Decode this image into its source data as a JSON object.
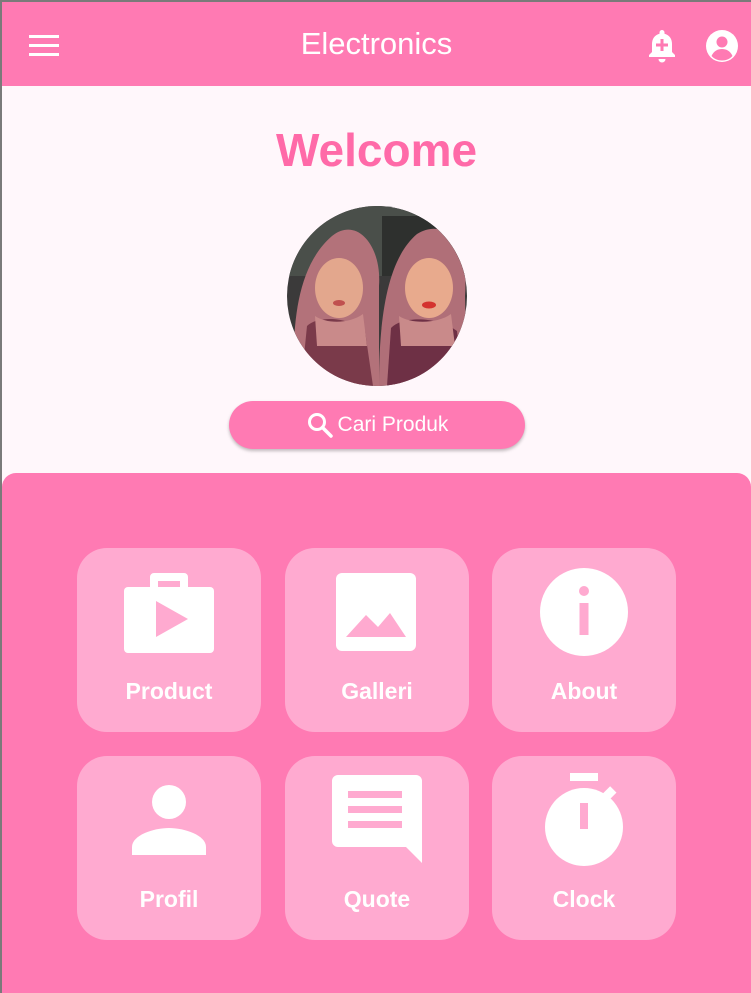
{
  "appbar": {
    "title": "Electronics",
    "menu_icon": "menu-icon",
    "notification_icon": "notification-add-icon",
    "account_icon": "account-circle-icon"
  },
  "welcome": {
    "heading": "Welcome"
  },
  "avatar": {
    "description": "profile photo"
  },
  "search": {
    "label": "Cari Produk",
    "icon": "search-icon"
  },
  "menu": {
    "tiles": [
      {
        "label": "Product",
        "icon": "shop-icon"
      },
      {
        "label": "Galleri",
        "icon": "image-icon"
      },
      {
        "label": "About",
        "icon": "info-icon"
      },
      {
        "label": "Profil",
        "icon": "person-icon"
      },
      {
        "label": "Quote",
        "icon": "chat-icon"
      },
      {
        "label": "Clock",
        "icon": "timer-icon"
      }
    ]
  },
  "colors": {
    "primary": "#ff7ab3",
    "tile": "#ffaad0",
    "heading": "#ff6aa8",
    "background": "#fff7fb"
  }
}
